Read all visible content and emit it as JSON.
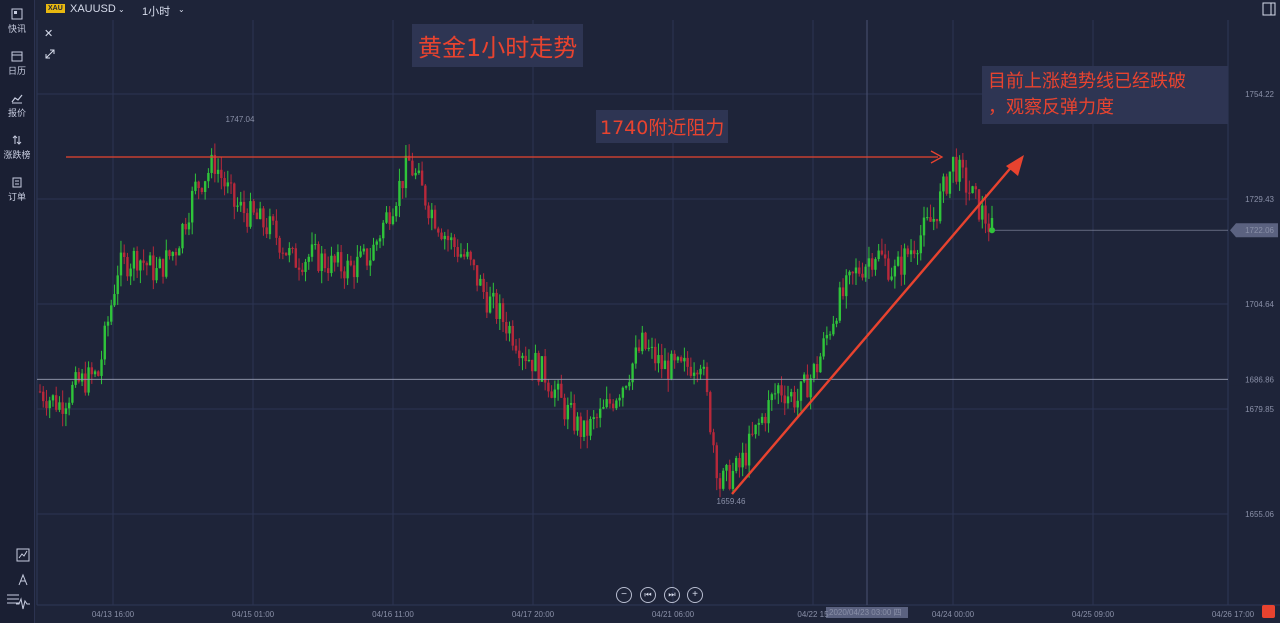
{
  "sidebar": {
    "items": [
      {
        "label": "快讯",
        "icon": "news-icon"
      },
      {
        "label": "日历",
        "icon": "calendar-icon"
      },
      {
        "label": "报价",
        "icon": "quote-chart-icon"
      },
      {
        "label": "涨跌榜",
        "icon": "updown-arrows-icon"
      },
      {
        "label": "订单",
        "icon": "order-clipboard-icon"
      }
    ]
  },
  "header": {
    "symbol_badge": "XAU",
    "symbol": "XAUUSD",
    "interval": "1小时"
  },
  "annotations": {
    "title": "黄金1小时走势",
    "resistance": "1740附近阻力",
    "note_line1": "目前上涨趋势线已经跌破",
    "note_line2": "，观察反弹力度"
  },
  "colors": {
    "background": "#1e2439",
    "up": "#2fc43a",
    "down": "#b8283a",
    "annotation": "#e8432f"
  },
  "chart_data": {
    "type": "candlestick",
    "symbol": "XAUUSD",
    "interval": "1小时",
    "y_ticks": [
      "1754.22",
      "1729.43",
      "1704.64",
      "1679.85",
      "1655.06"
    ],
    "ylim": [
      1645,
      1768
    ],
    "x_ticks": [
      "04/13 16:00",
      "04/15 01:00",
      "04/16 11:00",
      "04/17 20:00",
      "04/21 06:00",
      "04/22 15",
      "04/24 00:00",
      "04/25 09:00",
      "04/26 17:00"
    ],
    "crosshair_time": "2020/04/23 03:00",
    "crosshair_weekday": "四",
    "current_price": "1722.06",
    "horizontal_level": "1686.86",
    "high_label": "1747.04",
    "low_label": "1659.46",
    "close_path": [
      [
        0,
        1684
      ],
      [
        6,
        1681
      ],
      [
        12,
        1686
      ],
      [
        18,
        1688
      ],
      [
        24,
        1713
      ],
      [
        30,
        1716
      ],
      [
        36,
        1712
      ],
      [
        42,
        1718
      ],
      [
        48,
        1732
      ],
      [
        54,
        1738
      ],
      [
        60,
        1728
      ],
      [
        66,
        1725
      ],
      [
        72,
        1722
      ],
      [
        78,
        1715
      ],
      [
        84,
        1716
      ],
      [
        90,
        1714
      ],
      [
        96,
        1713
      ],
      [
        102,
        1716
      ],
      [
        108,
        1727
      ],
      [
        114,
        1738
      ],
      [
        120,
        1728
      ],
      [
        126,
        1720
      ],
      [
        132,
        1715
      ],
      [
        138,
        1706
      ],
      [
        144,
        1700
      ],
      [
        150,
        1693
      ],
      [
        156,
        1688
      ],
      [
        162,
        1680
      ],
      [
        168,
        1674
      ],
      [
        174,
        1679
      ],
      [
        180,
        1686
      ],
      [
        186,
        1695
      ],
      [
        192,
        1690
      ],
      [
        198,
        1689
      ],
      [
        204,
        1692
      ],
      [
        210,
        1662
      ],
      [
        216,
        1666
      ],
      [
        222,
        1676
      ],
      [
        228,
        1685
      ],
      [
        234,
        1682
      ],
      [
        240,
        1690
      ],
      [
        246,
        1704
      ],
      [
        252,
        1712
      ],
      [
        258,
        1717
      ],
      [
        264,
        1712
      ],
      [
        270,
        1719
      ],
      [
        276,
        1725
      ],
      [
        282,
        1738
      ],
      [
        288,
        1730
      ],
      [
        294,
        1722
      ]
    ]
  }
}
